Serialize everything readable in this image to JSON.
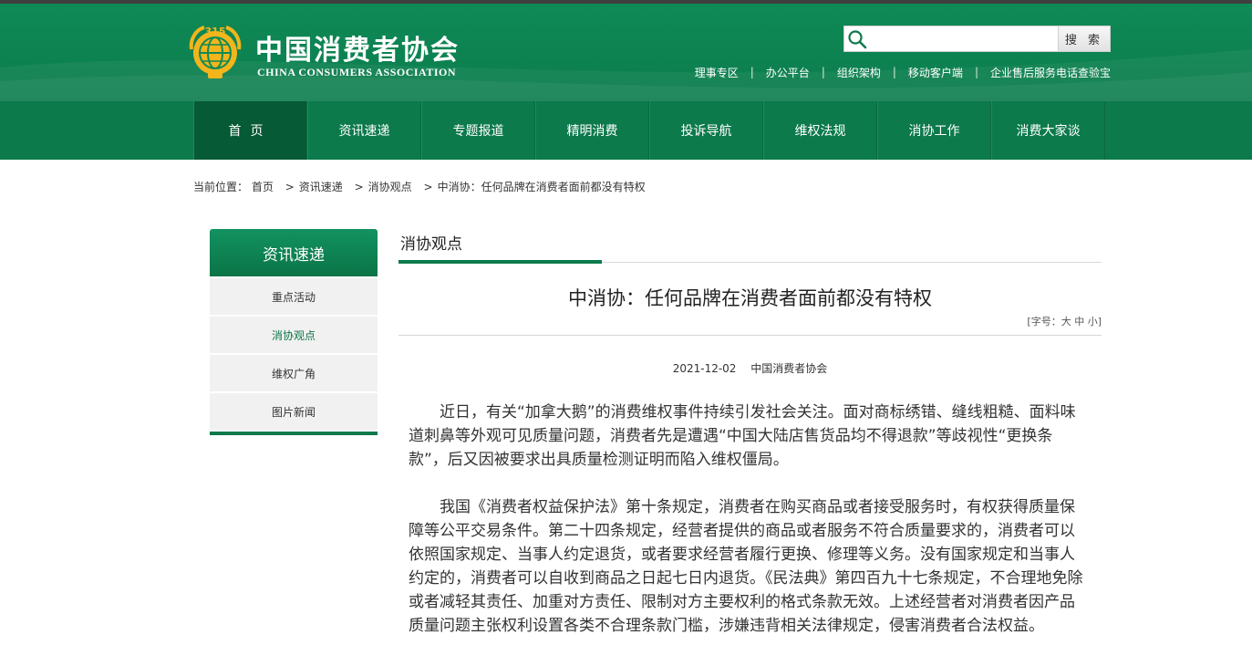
{
  "header": {
    "logo_cn": "中国消费者协会",
    "logo_en": "CHINA CONSUMERS ASSOCIATION",
    "logo_badge": "315",
    "search_placeholder": "",
    "search_button": "搜 索",
    "top_links": [
      "理事专区",
      "办公平台",
      "组织架构",
      "移动客户端",
      "企业售后服务电话查验宝"
    ],
    "separator": "|"
  },
  "nav": {
    "items": [
      {
        "label": "首页"
      },
      {
        "label": "资讯速递"
      },
      {
        "label": "专题报道"
      },
      {
        "label": "精明消费"
      },
      {
        "label": "投诉导航"
      },
      {
        "label": "维权法规"
      },
      {
        "label": "消协工作"
      },
      {
        "label": "消费大家谈"
      }
    ],
    "active_index": 0
  },
  "breadcrumb": {
    "prefix": "当前位置：",
    "items": [
      "首页",
      "资讯速递",
      "消协观点",
      "中消协：任何品牌在消费者面前都没有特权"
    ],
    "separator": ">"
  },
  "sidebar": {
    "title": "资讯速递",
    "items": [
      {
        "label": "重点活动"
      },
      {
        "label": "消协观点"
      },
      {
        "label": "维权广角"
      },
      {
        "label": "图片新闻"
      }
    ],
    "active_index": 1
  },
  "article": {
    "section": "消协观点",
    "title": "中消协：任何品牌在消费者面前都没有特权",
    "font_size_prefix": "[字号：",
    "font_sizes": [
      "大",
      "中",
      "小"
    ],
    "font_size_suffix": "]",
    "date": "2021-12-02",
    "source": "中国消费者协会",
    "paragraphs": [
      "近日，有关“加拿大鹅”的消费维权事件持续引发社会关注。面对商标绣错、缝线粗糙、面料味道刺鼻等外观可见质量问题，消费者先是遭遇“中国大陆店售货品均不得退款”等歧视性“更换条款”，后又因被要求出具质量检测证明而陷入维权僵局。",
      "我国《消费者权益保护法》第十条规定，消费者在购买商品或者接受服务时，有权获得质量保障等公平交易条件。第二十四条规定，经营者提供的商品或者服务不符合质量要求的，消费者可以依照国家规定、当事人约定退货，或者要求经营者履行更换、修理等义务。没有国家规定和当事人约定的，消费者可以自收到商品之日起七日内退货。《民法典》第四百九十七条规定，不合理地免除或者减轻其责任、加重对方责任、限制对方主要权利的格式条款无效。上述经营者对消费者因产品质量问题主张权利设置各类不合理条款门槛，涉嫌违背相关法律规定，侵害消费者合法权益。"
    ]
  },
  "colors": {
    "brand_green": "#0c7a4b",
    "nav_active": "#065a35",
    "logo_gold": "#f2b51c"
  }
}
